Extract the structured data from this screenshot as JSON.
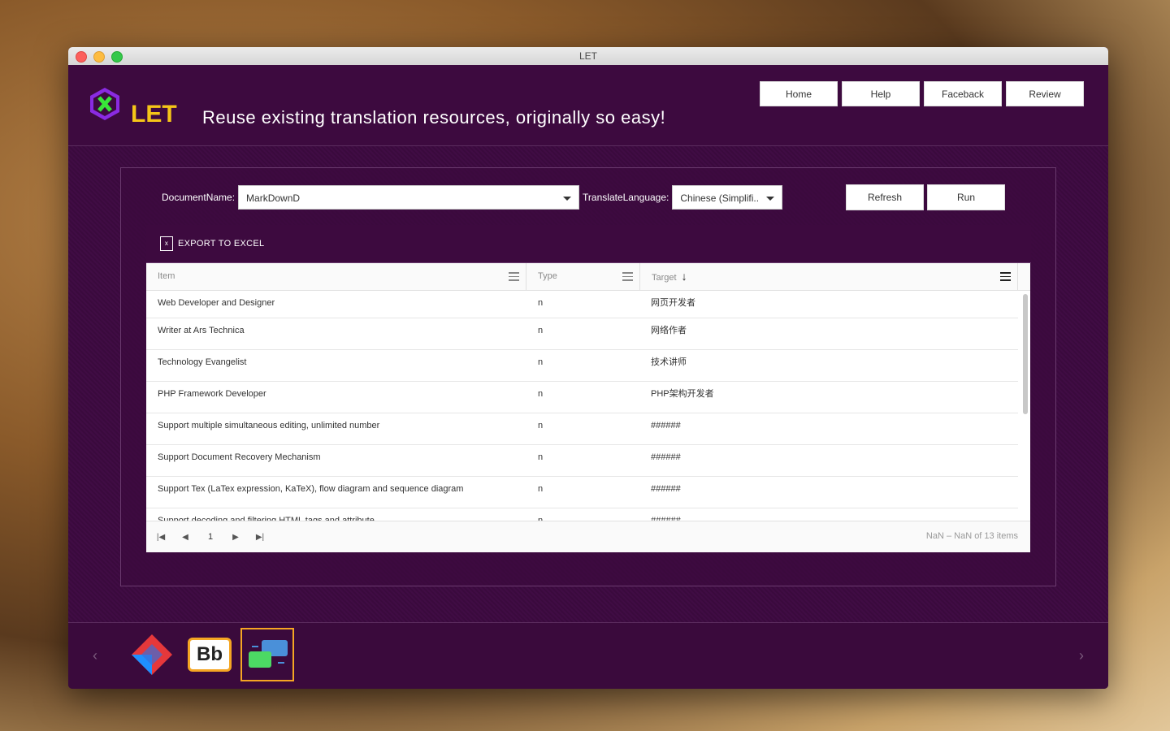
{
  "window": {
    "title": "LET"
  },
  "header": {
    "logo_text": "LET",
    "tagline": "Reuse existing translation resources, originally so easy!",
    "nav": [
      "Home",
      "Help",
      "Faceback",
      "Review"
    ]
  },
  "form": {
    "document_label": "DocumentName:",
    "document_value": "MarkDownD",
    "language_label": "TranslateLanguage:",
    "language_value": "Chinese (Simplifi..",
    "refresh_label": "Refresh",
    "run_label": "Run"
  },
  "toolbar": {
    "export_label": "EXPORT TO EXCEL"
  },
  "grid": {
    "columns": [
      "Item",
      "Type",
      "Target"
    ],
    "sort_indicator": "↓",
    "rows": [
      {
        "item": "Web Developer and Designer",
        "type": "n",
        "target": "网页开发者"
      },
      {
        "item": "Writer at Ars Technica",
        "type": "n",
        "target": "网络作者"
      },
      {
        "item": "Technology Evangelist",
        "type": "n",
        "target": "技术讲师"
      },
      {
        "item": "PHP Framework Developer",
        "type": "n",
        "target": "PHP架构开发者"
      },
      {
        "item": "Support multiple simultaneous editing, unlimited number",
        "type": "n",
        "target": "######"
      },
      {
        "item": "Support Document Recovery Mechanism",
        "type": "n",
        "target": "######"
      },
      {
        "item": "Support Tex (LaTex expression, KaTeX), flow diagram and sequence diagram",
        "type": "n",
        "target": "######"
      },
      {
        "item": "Support decoding and filtering HTML tags and attribute",
        "type": "n",
        "target": "######"
      }
    ],
    "pager": {
      "page": "1",
      "info": "NaN – NaN of 13 items"
    }
  },
  "dock": {
    "apps": [
      "diamond-app-icon",
      "bb-app-icon",
      "let-app-icon"
    ],
    "bb_label": "Bb"
  }
}
